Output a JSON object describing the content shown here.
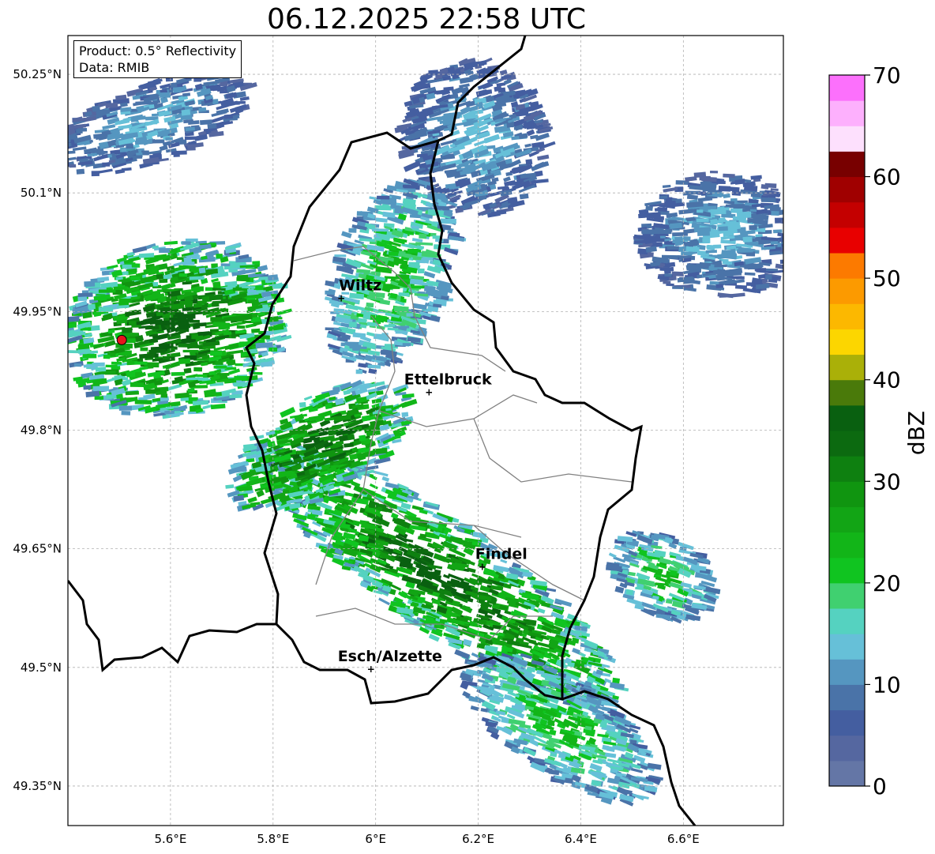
{
  "title": "06.12.2025 22:58 UTC",
  "info": {
    "product": "Product: 0.5° Reflectivity",
    "data": "Data: RMIB"
  },
  "extent": {
    "lon_min": 5.4,
    "lon_max": 6.795,
    "lat_min": 49.3,
    "lat_max": 50.299
  },
  "lat_ticks": [
    {
      "value": 50.25,
      "label": "50.25°N"
    },
    {
      "value": 50.1,
      "label": "50.1°N"
    },
    {
      "value": 49.95,
      "label": "49.95°N"
    },
    {
      "value": 49.8,
      "label": "49.8°N"
    },
    {
      "value": 49.65,
      "label": "49.65°N"
    },
    {
      "value": 49.5,
      "label": "49.5°N"
    },
    {
      "value": 49.35,
      "label": "49.35°N"
    }
  ],
  "lon_ticks": [
    {
      "value": 5.6,
      "label": "5.6°E"
    },
    {
      "value": 5.8,
      "label": "5.8°E"
    },
    {
      "value": 6.0,
      "label": "6°E"
    },
    {
      "value": 6.2,
      "label": "6.2°E"
    },
    {
      "value": 6.4,
      "label": "6.4°E"
    },
    {
      "value": 6.6,
      "label": "6.6°E"
    }
  ],
  "radar_site": {
    "lon": 5.505,
    "lat": 49.914,
    "color": "#e8141c"
  },
  "cities": [
    {
      "name": "Wiltz",
      "lon": 5.933,
      "lat": 49.967
    },
    {
      "name": "Ettelbruck",
      "lon": 6.104,
      "lat": 49.848
    },
    {
      "name": "Findel",
      "lon": 6.208,
      "lat": 49.627
    },
    {
      "name": "Esch/Alzette",
      "lon": 5.991,
      "lat": 49.498
    }
  ],
  "colorbar": {
    "label": "dBZ",
    "min": 0,
    "max": 70,
    "step": 2.5,
    "ticks": [
      {
        "value": 0,
        "label": "0"
      },
      {
        "value": 10,
        "label": "10"
      },
      {
        "value": 20,
        "label": "20"
      },
      {
        "value": 30,
        "label": "30"
      },
      {
        "value": 40,
        "label": "40"
      },
      {
        "value": 50,
        "label": "50"
      },
      {
        "value": 60,
        "label": "60"
      },
      {
        "value": 70,
        "label": "70"
      }
    ],
    "colors": [
      "#6476a6",
      "#5567a0",
      "#445ea0",
      "#4a73a8",
      "#5596c0",
      "#66c0d8",
      "#55d2c0",
      "#40d070",
      "#10c420",
      "#12b518",
      "#12a515",
      "#109510",
      "#0e8010",
      "#0c6a10",
      "#096010",
      "#4a7a0a",
      "#aab008",
      "#fcd600",
      "#fcb800",
      "#fc9a00",
      "#fc7a00",
      "#e80000",
      "#c40000",
      "#a00000",
      "#780000",
      "#fde0fd",
      "#fdb0fd",
      "#fc70fc",
      "#e840e8"
    ]
  },
  "rain_bands": [
    {
      "name": "northwest-cluster",
      "lon": 5.6,
      "lat": 49.93,
      "rx": 0.22,
      "ry": 0.11,
      "rot": -15,
      "level": 3
    },
    {
      "name": "southeast-main-band",
      "lon": 6.12,
      "lat": 49.62,
      "rx": 0.42,
      "ry": 0.07,
      "rot": 35,
      "level": 3
    },
    {
      "name": "southeast-tail",
      "lon": 6.35,
      "lat": 49.43,
      "rx": 0.22,
      "ry": 0.06,
      "rot": 35,
      "level": 2
    },
    {
      "name": "northeast-cells",
      "lon": 6.66,
      "lat": 50.05,
      "rx": 0.16,
      "ry": 0.08,
      "rot": 0,
      "level": 1
    },
    {
      "name": "north-german-band",
      "lon": 6.18,
      "lat": 50.17,
      "rx": 0.14,
      "ry": 0.1,
      "rot": -30,
      "level": 1
    },
    {
      "name": "east-cell",
      "lon": 6.55,
      "lat": 49.62,
      "rx": 0.11,
      "ry": 0.05,
      "rot": 30,
      "level": 2
    },
    {
      "name": "wiltz-area",
      "lon": 6.02,
      "lat": 50.0,
      "rx": 0.11,
      "ry": 0.13,
      "rot": 20,
      "level": 2
    },
    {
      "name": "northwest-upper",
      "lon": 5.55,
      "lat": 50.19,
      "rx": 0.2,
      "ry": 0.05,
      "rot": -20,
      "level": 1
    },
    {
      "name": "mid-band",
      "lon": 5.88,
      "lat": 49.78,
      "rx": 0.2,
      "ry": 0.06,
      "rot": -30,
      "level": 3
    }
  ]
}
